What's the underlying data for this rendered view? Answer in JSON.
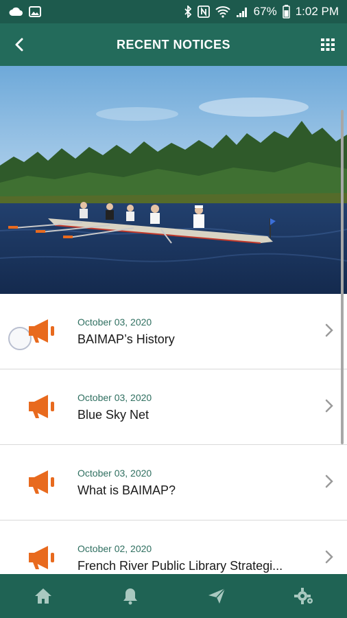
{
  "status_bar": {
    "battery": "67%",
    "time": "1:02 PM",
    "icons": [
      "cloud-icon",
      "image-icon",
      "bluetooth-icon",
      "nfc-icon",
      "wifi-icon",
      "signal-icon",
      "battery-icon"
    ]
  },
  "app_bar": {
    "title": "RECENT NOTICES",
    "icons": [
      "back-arrow-icon",
      "grid-menu-icon"
    ]
  },
  "hero": {
    "alt_icon": "photo-rowing-boat"
  },
  "notices": [
    {
      "date": "October 03, 2020",
      "title": "BAIMAP’s History"
    },
    {
      "date": "October 03, 2020",
      "title": "Blue Sky Net"
    },
    {
      "date": "October 03, 2020",
      "title": "What is BAIMAP?"
    },
    {
      "date": "October 02, 2020",
      "title": "French River Public Library Strategi..."
    }
  ],
  "bottom_nav": {
    "items": [
      "home-icon",
      "bell-icon",
      "send-icon",
      "settings-icon"
    ]
  },
  "colors": {
    "status_bar": "#1d5a4d",
    "app_bar": "#236b5b",
    "bottom_nav": "#1f6354",
    "accent_orange": "#e86a1e",
    "date_text": "#2f6f60"
  }
}
